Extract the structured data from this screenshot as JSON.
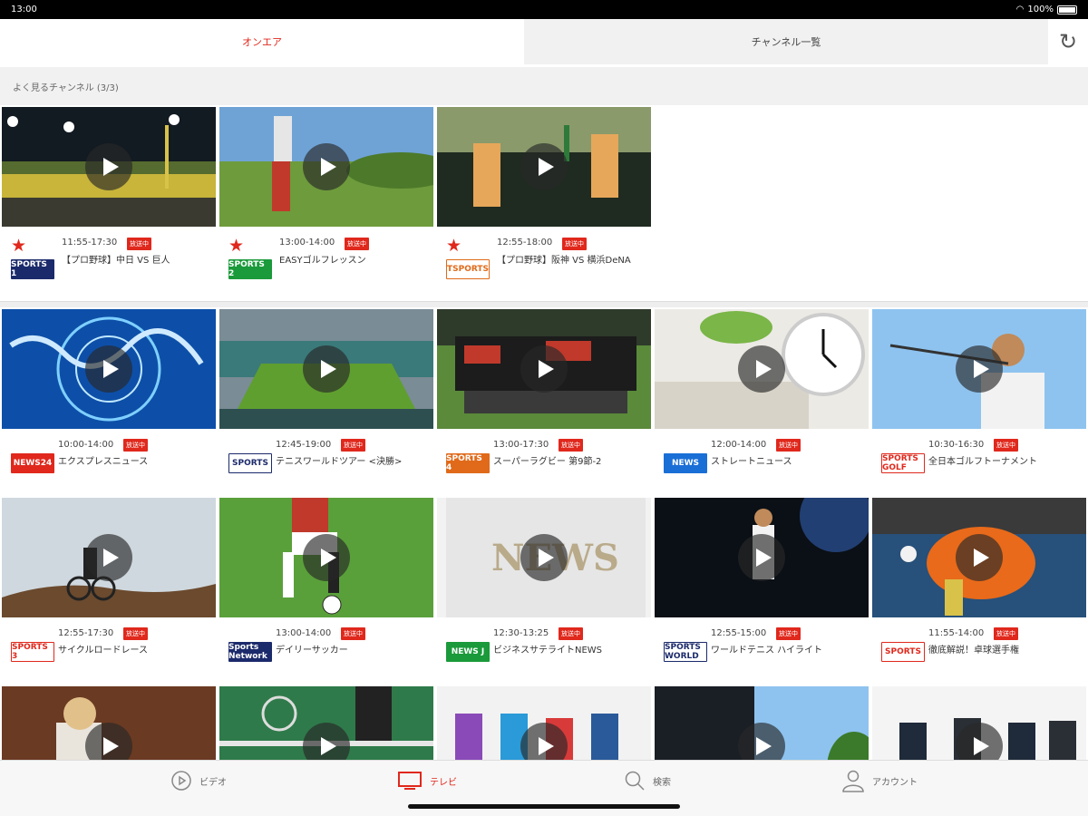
{
  "status_bar": {
    "time": "13:00",
    "battery": "100%"
  },
  "tabs": {
    "onair": "オンエア",
    "channel_list": "チャンネル一覧"
  },
  "favorites_header": "よく見るチャンネル (3/3)",
  "favorites": [
    {
      "time": "11:55-17:30",
      "badge": "放送中",
      "title": "【プロ野球】中日 VS 巨人",
      "channel": "SPORTS 1",
      "logo_color": "#1b2a6b",
      "logo_text_color": "#fff",
      "scene": "stadium-night"
    },
    {
      "time": "13:00-14:00",
      "badge": "放送中",
      "title": "EASYゴルフレッスン",
      "channel": "SPORTS 2",
      "logo_color": "#1a9a3a",
      "logo_text_color": "#fff",
      "scene": "golf-swing"
    },
    {
      "time": "12:55-18:00",
      "badge": "放送中",
      "title": "【プロ野球】阪神 VS 横浜DeNA",
      "channel": "TSPORTS",
      "logo_color": "#ffffff",
      "logo_text_color": "#e06a1a",
      "scene": "fans"
    }
  ],
  "channels": [
    {
      "time": "10:00-14:00",
      "badge": "放送中",
      "title": "エクスプレスニュース",
      "channel": "NEWS24",
      "logo_color": "#e0281c",
      "logo_text_color": "#fff",
      "scene": "globe"
    },
    {
      "time": "12:45-19:00",
      "badge": "放送中",
      "title": "テニスワールドツアー <決勝>",
      "channel": "SPORTS",
      "logo_color": "#ffffff",
      "logo_text_color": "#1b2a6b",
      "scene": "tennis-court"
    },
    {
      "time": "13:00-17:30",
      "badge": "放送中",
      "title": "スーパーラグビー 第9節-2",
      "channel": "SPORTS 4",
      "logo_color": "#e06a1a",
      "logo_text_color": "#fff",
      "scene": "rugby"
    },
    {
      "time": "12:00-14:00",
      "badge": "放送中",
      "title": "ストレートニュース",
      "channel": "NEWS",
      "logo_color": "#1a6fd6",
      "logo_text_color": "#fff",
      "scene": "clock"
    },
    {
      "time": "10:30-16:30",
      "badge": "放送中",
      "title": "全日本ゴルフトーナメント",
      "channel": "SPORTS GOLF",
      "logo_color": "#ffffff",
      "logo_text_color": "#e0281c",
      "scene": "golfer-man"
    },
    {
      "time": "12:55-17:30",
      "badge": "放送中",
      "title": "サイクルロードレース",
      "channel": "SPORTS 3",
      "logo_color": "#ffffff",
      "logo_text_color": "#e0281c",
      "scene": "cyclist"
    },
    {
      "time": "13:00-14:00",
      "badge": "放送中",
      "title": "デイリーサッカー",
      "channel": "Sports Network",
      "logo_color": "#1b2a6b",
      "logo_text_color": "#fff",
      "scene": "soccer"
    },
    {
      "time": "12:30-13:25",
      "badge": "放送中",
      "title": "ビジネスサテライトNEWS",
      "channel": "NEWS J",
      "logo_color": "#1a9a3a",
      "logo_text_color": "#fff",
      "scene": "newspaper"
    },
    {
      "time": "12:55-15:00",
      "badge": "放送中",
      "title": "ワールドテニス ハイライト",
      "channel": "SPORTS WORLD",
      "logo_color": "#ffffff",
      "logo_text_color": "#1b2a6b",
      "scene": "tennis-player"
    },
    {
      "time": "11:55-14:00",
      "badge": "放送中",
      "title": "徹底解説！卓球選手権",
      "channel": "SPORTS",
      "logo_color": "#ffffff",
      "logo_text_color": "#e0281c",
      "scene": "pingpong"
    },
    {
      "scene": "woman-cafe"
    },
    {
      "scene": "tennis-green"
    },
    {
      "scene": "kids"
    },
    {
      "scene": "sky-tree"
    },
    {
      "scene": "business"
    }
  ],
  "tabbar": {
    "video": "ビデオ",
    "tv": "テレビ",
    "search": "検索",
    "account": "アカウント"
  }
}
